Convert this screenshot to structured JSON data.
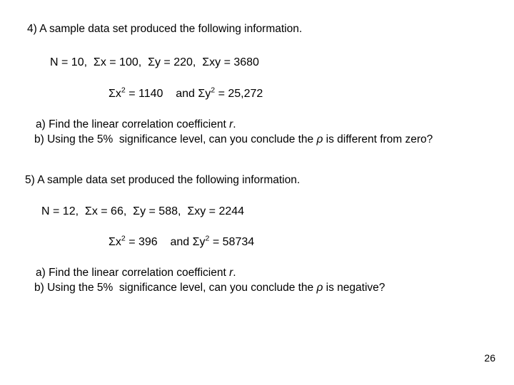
{
  "slide": {
    "background_color": "#ffffff",
    "text_color": "#000000",
    "page_number": "26"
  },
  "questions": [
    {
      "number": "4)",
      "prompt": "4) A sample data set produced the following information.",
      "stats_line": "N = 10,  Σx = 100,  Σy = 220,  Σxy = 3680",
      "stats": {
        "N": "10",
        "sum_x": "100",
        "sum_y": "220",
        "sum_xy": "3680",
        "sum_x_squared": "1140",
        "sum_y_squared": "25,272"
      },
      "squares": {
        "lhs_symbol": "Σx",
        "lhs_exponent": "2",
        "lhs_value": "= 1140",
        "conjunction": "and",
        "rhs_symbol": "Σy",
        "rhs_exponent": "2",
        "rhs_value": "= 25,272"
      },
      "part_a": {
        "label": "a)",
        "text_before": "a) Find the linear correlation coefficient ",
        "variable": "r",
        "text_after": "."
      },
      "part_b": {
        "label": "b)",
        "text_before": "b) Using the 5%  significance level, can you conclude the ",
        "variable": "ρ",
        "text_after": " is different from zero?"
      }
    },
    {
      "number": "5)",
      "prompt": "5) A sample data set produced the following information.",
      "stats_line": "N = 12,  Σx = 66,  Σy = 588,  Σxy = 2244",
      "stats": {
        "N": "12",
        "sum_x": "66",
        "sum_y": "588",
        "sum_xy": "2244",
        "sum_x_squared": "396",
        "sum_y_squared": "58734"
      },
      "squares": {
        "lhs_symbol": "Σx",
        "lhs_exponent": "2",
        "lhs_value": "= 396",
        "conjunction": "and",
        "rhs_symbol": "Σy",
        "rhs_exponent": "2",
        "rhs_value": "= 58734"
      },
      "part_a": {
        "label": "a)",
        "text_before": "a) Find the linear correlation coefficient ",
        "variable": "r",
        "text_after": "."
      },
      "part_b": {
        "label": "b)",
        "text_before": "b) Using the 5%  significance level, can you conclude the ",
        "variable": "ρ",
        "text_after": " is negative?"
      }
    }
  ]
}
